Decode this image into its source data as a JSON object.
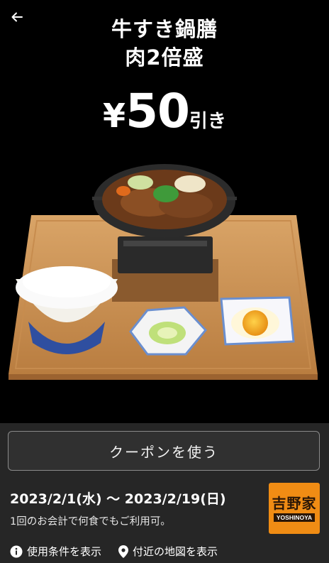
{
  "header": {
    "back_icon": "arrow-left-icon",
    "title_line1": "牛すき鍋膳",
    "title_line2": "肉2倍盛",
    "price_yen": "¥",
    "price_amount": "50",
    "price_suffix": "引き"
  },
  "coupon": {
    "use_button_label": "クーポンを使う",
    "period": "2023/2/1(水) 〜 2023/2/19(日)",
    "note": "1回のお会計で何食でもご利用可。",
    "brand_logo_kanji": "吉野家",
    "brand_logo_roman": "YOSHINOYA",
    "brand_color": "#f08c14"
  },
  "links": {
    "terms_label": "使用条件を表示",
    "terms_icon": "info-icon",
    "map_label": "付近の地図を表示",
    "map_icon": "location-pin-icon"
  }
}
